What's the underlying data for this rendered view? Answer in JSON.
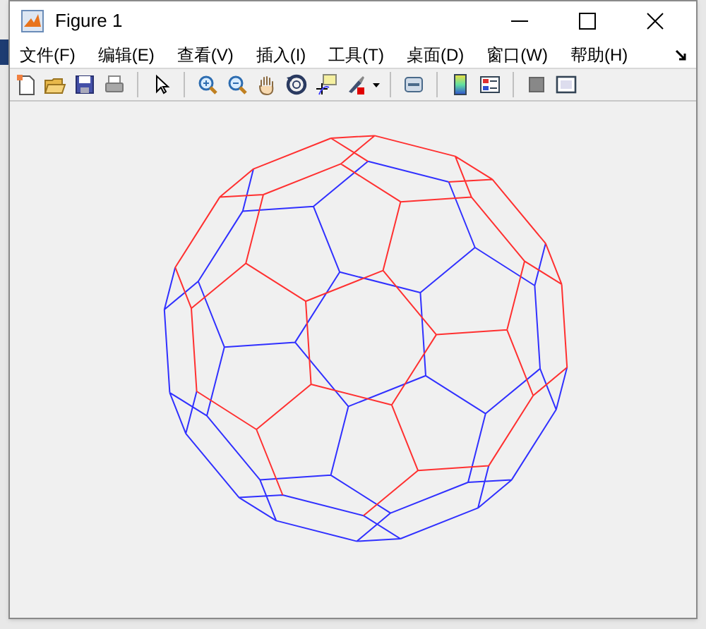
{
  "window": {
    "title": "Figure 1"
  },
  "menu": [
    "文件(F)",
    "编辑(E)",
    "查看(V)",
    "插入(I)",
    "工具(T)",
    "桌面(D)",
    "窗口(W)",
    "帮助(H)"
  ],
  "toolbar": [
    {
      "kind": "new"
    },
    {
      "kind": "open"
    },
    {
      "kind": "save"
    },
    {
      "kind": "print"
    },
    {
      "kind": "sep"
    },
    {
      "kind": "pointer"
    },
    {
      "kind": "sep"
    },
    {
      "kind": "zoomin"
    },
    {
      "kind": "zoomout"
    },
    {
      "kind": "pan"
    },
    {
      "kind": "rotate"
    },
    {
      "kind": "cursor"
    },
    {
      "kind": "brush"
    },
    {
      "kind": "sep"
    },
    {
      "kind": "link"
    },
    {
      "kind": "sep"
    },
    {
      "kind": "colorbar"
    },
    {
      "kind": "legend"
    },
    {
      "kind": "sep"
    },
    {
      "kind": "hide"
    },
    {
      "kind": "show"
    }
  ]
}
